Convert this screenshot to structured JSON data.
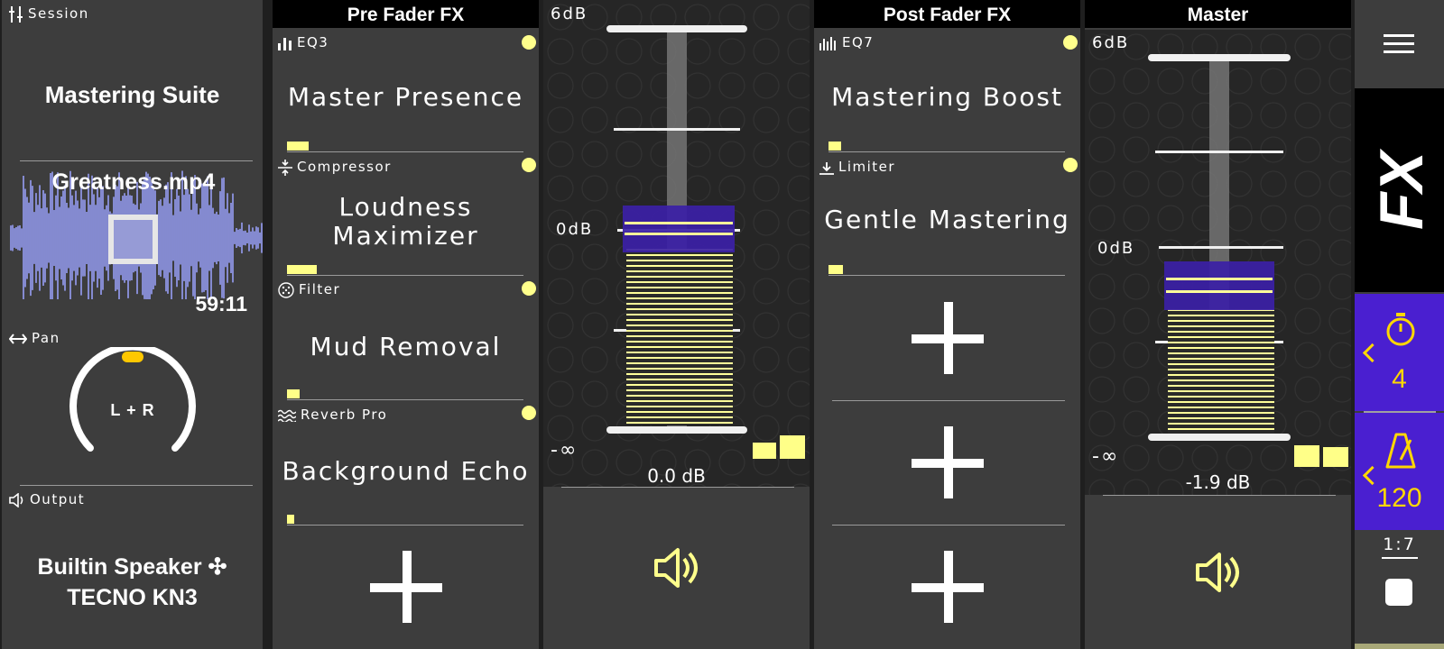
{
  "session": {
    "label": "Session",
    "title": "Mastering Suite",
    "file_name": "Greatness.mp4",
    "duration": "59:11",
    "pan_label": "Pan",
    "pan_value": "L + R",
    "output_label": "Output",
    "output_line1": "Builtin Speaker ✣",
    "output_line2": "TECNO KN3"
  },
  "pre_fader": {
    "title": "Pre Fader FX",
    "effects": [
      {
        "type": "EQ3",
        "name": "Master Presence",
        "mix": 0.1
      },
      {
        "type": "Compressor",
        "name_line1": "Loudness",
        "name_line2": "Maximizer",
        "mix": 0.12
      },
      {
        "type": "Filter",
        "name": "Mud Removal",
        "mix": 0.05
      },
      {
        "type": "Reverb Pro",
        "name": "Background Echo",
        "mix": 0.03
      }
    ]
  },
  "fader1": {
    "top_label": "6dB",
    "zero_label": "0dB",
    "bottom_label": "-∞",
    "value": "0.0 dB"
  },
  "post_fader": {
    "title": "Post Fader FX",
    "effects": [
      {
        "type": "EQ7",
        "name": "Mastering Boost",
        "mix": 0.05
      },
      {
        "type": "Limiter",
        "name": "Gentle Mastering",
        "mix": 0.06
      }
    ]
  },
  "master": {
    "title": "Master",
    "top_label": "6dB",
    "zero_label": "0dB",
    "bottom_label": "-∞",
    "value": "-1.9 dB"
  },
  "sidebar": {
    "timer_value": "4",
    "tempo_value": "120",
    "ratio": "1:7"
  },
  "colors": {
    "accent_yellow": "#ffff88",
    "purple": "#4a1fd0",
    "pan_knob": "#ffc800"
  }
}
